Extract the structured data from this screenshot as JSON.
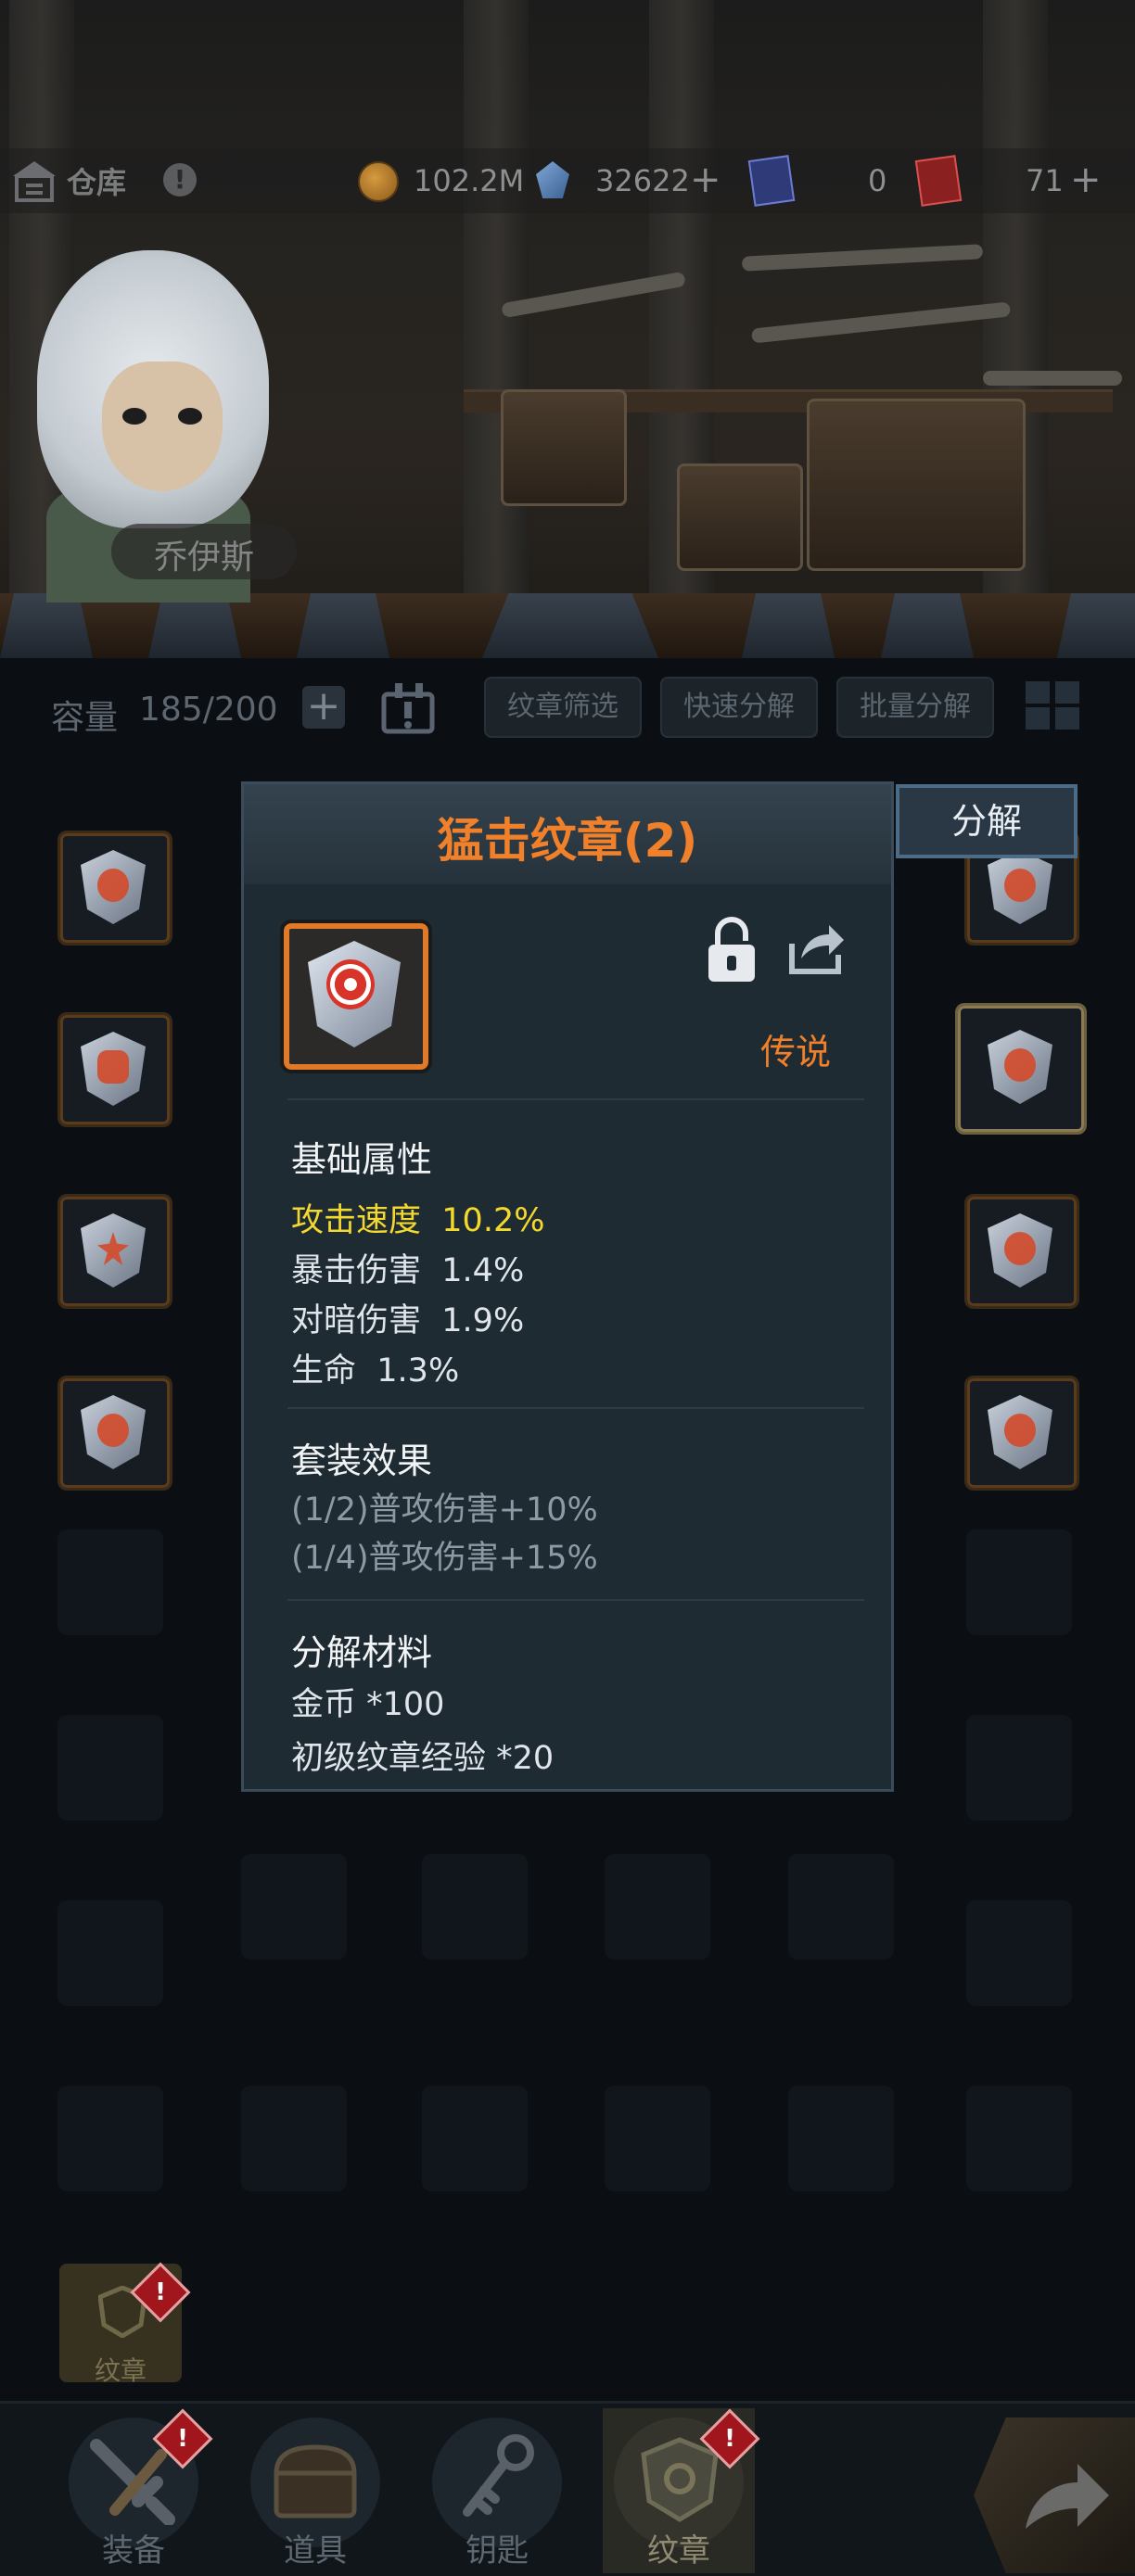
{
  "header": {
    "title": "仓库",
    "gold": "102.2M",
    "gems": "32622",
    "blue_tickets": "0",
    "red_tickets": "71",
    "icons": [
      "warehouse-icon",
      "info-icon",
      "gold-coin-icon",
      "gem-icon",
      "blue-ticket-icon",
      "red-ticket-icon"
    ]
  },
  "hero": {
    "name": "乔伊斯"
  },
  "toolbar": {
    "capacity_label": "容量",
    "capacity_value": "185/200",
    "filter": "纹章筛选",
    "quick_decompose": "快速分解",
    "batch_decompose": "批量分解"
  },
  "popup": {
    "title": "猛击纹章(2)",
    "decompose_button": "分解",
    "rarity": "传说",
    "base_title": "基础属性",
    "stats": [
      {
        "name": "攻击速度",
        "value": "10.2%"
      },
      {
        "name": "暴击伤害",
        "value": "1.4%"
      },
      {
        "name": "对暗伤害",
        "value": "1.9%"
      },
      {
        "name": "生命",
        "value": "1.3%"
      }
    ],
    "set_title": "套装效果",
    "set_effects": [
      "(1/2)普攻伤害+10%",
      "(1/4)普攻伤害+15%"
    ],
    "material_title": "分解材料",
    "materials": [
      "金币 *100",
      "初级纹章经验 *20"
    ]
  },
  "bottom": {
    "emblem_tag": "纹章",
    "badge": "!",
    "tabs": [
      "装备",
      "道具",
      "钥匙",
      "纹章"
    ]
  },
  "colors": {
    "accent": "#f0802a",
    "highlight": "#f3d92d",
    "panel": "#1f2b33"
  }
}
